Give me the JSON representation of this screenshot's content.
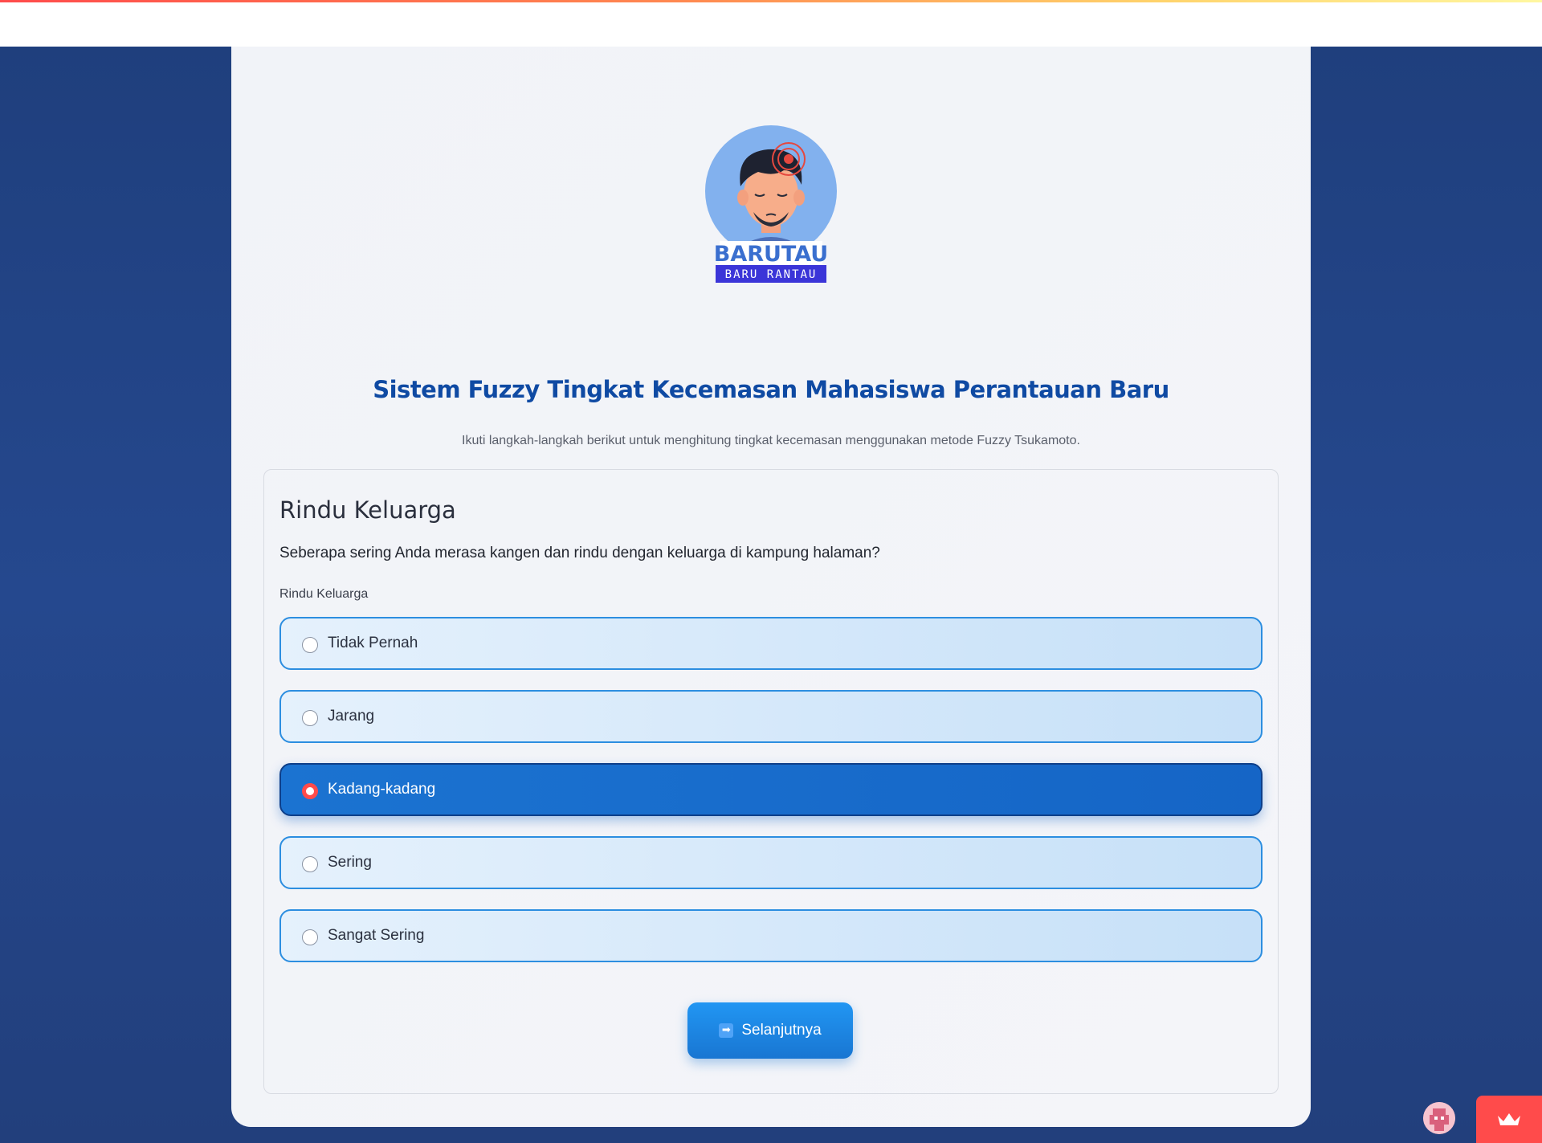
{
  "colors": {
    "brand_primary": "#0f4aa3",
    "accent_blue": "#1976d2",
    "selected_radio": "#ff4b4b",
    "app_background": "#25488e",
    "card_background": "#f3f4f8"
  },
  "logo": {
    "name": "BARUTAU",
    "tagline": "BARU RANTAU"
  },
  "page": {
    "title": "Sistem Fuzzy Tingkat Kecemasan Mahasiswa Perantauan Baru",
    "subtitle": "Ikuti langkah-langkah berikut untuk menghitung tingkat kecemasan menggunakan metode Fuzzy Tsukamoto."
  },
  "question": {
    "title": "Rindu Keluarga",
    "text": "Seberapa sering Anda merasa kangen dan rindu dengan keluarga di kampung halaman?",
    "radio_label": "Rindu Keluarga",
    "options": [
      {
        "label": "Tidak Pernah",
        "selected": false
      },
      {
        "label": "Jarang",
        "selected": false
      },
      {
        "label": "Kadang-kadang",
        "selected": true
      },
      {
        "label": "Sering",
        "selected": false
      },
      {
        "label": "Sangat Sering",
        "selected": false
      }
    ],
    "selected_value": "Kadang-kadang"
  },
  "actions": {
    "next_label": "Selanjutnya",
    "next_icon": "right-arrow-icon"
  },
  "footer_widgets": {
    "avatar_icon": "user-avatar-icon",
    "crown_icon": "crown-icon"
  }
}
